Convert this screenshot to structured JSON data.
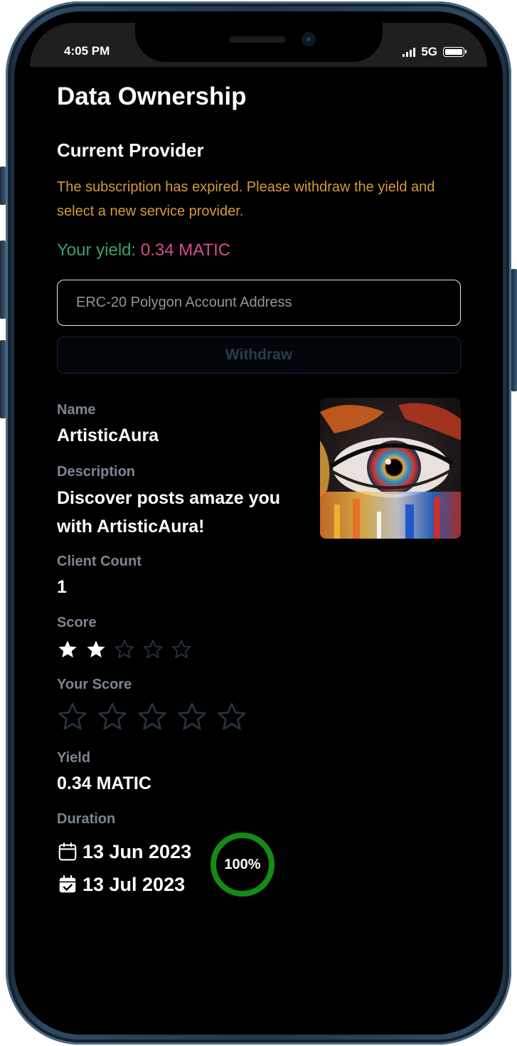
{
  "status_bar": {
    "time": "4:05 PM",
    "network": "5G"
  },
  "page": {
    "title": "Data Ownership"
  },
  "provider": {
    "section_title": "Current Provider",
    "notice": "The subscription has expired. Please withdraw the yield and select a new service provider.",
    "yield_label": "Your yield:",
    "yield_value": "0.34 MATIC",
    "address_placeholder": "ERC-20 Polygon Account Address",
    "address_value": "",
    "withdraw_label": "Withdraw"
  },
  "details": {
    "name_label": "Name",
    "name": "ArtisticAura",
    "description_label": "Description",
    "description": "Discover posts amaze you with ArtisticAura!",
    "client_count_label": "Client Count",
    "client_count": "1",
    "score_label": "Score",
    "score": 2,
    "score_max": 5,
    "your_score_label": "Your Score",
    "your_score": 0,
    "your_score_max": 5,
    "yield_label": "Yield",
    "yield": "0.34 MATIC",
    "duration_label": "Duration",
    "start_date": "13 Jun 2023",
    "end_date": "13 Jul 2023",
    "progress_text": "100%",
    "progress": 1.0
  },
  "colors": {
    "notice": "#d59a3a",
    "yield_label": "#3fa06a",
    "yield_value": "#d44e88",
    "label": "#7d8593",
    "progress_ring": "#168a16",
    "star_filled": "#ffffff",
    "star_empty": "#2b3442"
  },
  "icons": {
    "score_star": "star-icon",
    "start_date": "calendar-icon",
    "end_date": "calendar-check-icon",
    "thumbnail": "provider-avatar-image"
  }
}
